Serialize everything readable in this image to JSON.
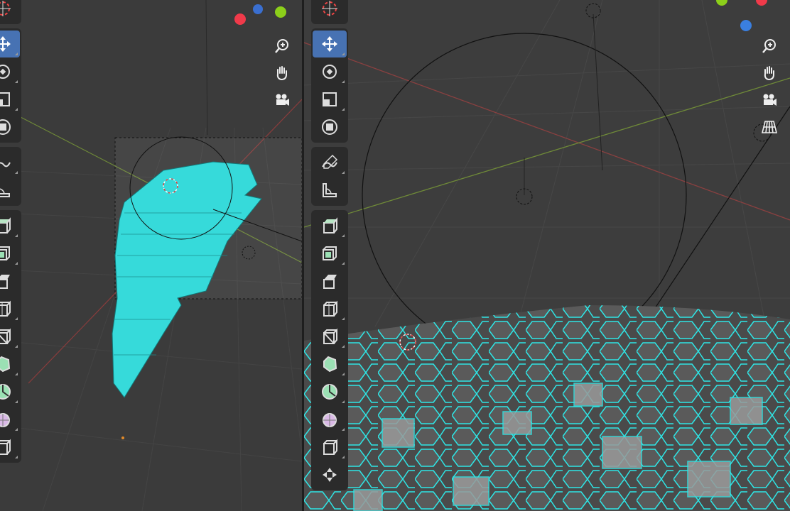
{
  "colors": {
    "viewport_bg": "#3b3b3b",
    "toolbar_bg": "#2b2b2b",
    "active_tool": "#4772b3",
    "mesh_cyan": "#2ee6e6",
    "x_axis": "#b54a4a",
    "y_axis": "#7a9a3a",
    "gizmo_red": "#f03a4a",
    "gizmo_green": "#8ccf1a",
    "gizmo_blue": "#3a7fe0"
  },
  "left_viewport": {
    "tools": [
      {
        "name": "cursor-icon",
        "active": false
      },
      {
        "name": "move-icon",
        "active": true
      },
      {
        "name": "rotate-icon",
        "active": false
      },
      {
        "name": "scale-icon",
        "active": false
      },
      {
        "name": "transform-icon",
        "active": false
      },
      {
        "name": "annotate-icon",
        "active": false
      },
      {
        "name": "measure-icon",
        "active": false
      },
      {
        "name": "add-cube-icon",
        "active": false
      },
      {
        "name": "extrude-region-icon",
        "active": false
      },
      {
        "name": "inset-faces-icon",
        "active": false
      },
      {
        "name": "bevel-icon",
        "active": false
      },
      {
        "name": "loop-cut-icon",
        "active": false
      },
      {
        "name": "knife-icon",
        "active": false
      },
      {
        "name": "poly-build-icon",
        "active": false
      },
      {
        "name": "spin-icon",
        "active": false
      },
      {
        "name": "smooth-icon",
        "active": false
      },
      {
        "name": "edge-slide-icon",
        "active": false
      }
    ],
    "nav": [
      "zoom-icon",
      "hand-icon",
      "camera-icon"
    ]
  },
  "right_viewport": {
    "nav": [
      "zoom-icon",
      "hand-icon",
      "camera-icon",
      "perspective-grid-icon"
    ]
  }
}
